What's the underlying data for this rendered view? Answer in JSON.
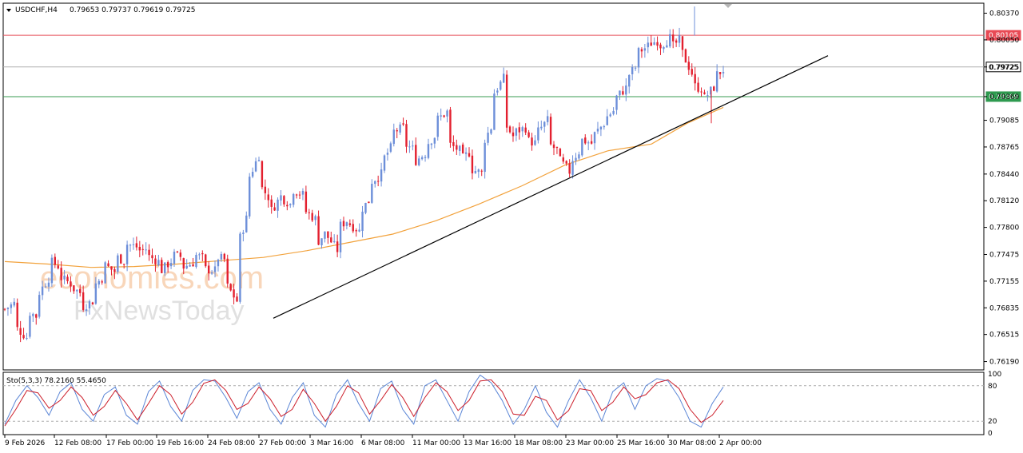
{
  "header": {
    "symbol": "USDCHF,H4",
    "quote": "0.79653 0.79737 0.79619 0.79725"
  },
  "watermark": {
    "line1": "economies.com",
    "line2": "FxNewsToday"
  },
  "colors": {
    "up": "#6d8fd9",
    "down": "#e3202f",
    "ma": "#f2a23c",
    "resistance": "#e8505b",
    "current": "#b0b0b0",
    "support": "#3a9b52",
    "trend": "#000000",
    "sto_main": "#5b86d6",
    "sto_signal": "#cc1f2b"
  },
  "chart_data": [
    {
      "type": "candlestick",
      "symbol": "USDCHF",
      "timeframe": "H4",
      "ylim": [
        0.7609,
        0.8049
      ],
      "y_ticks": [
        "0.80370",
        "0.80050",
        "0.79725",
        "0.79369",
        "0.79085",
        "0.78765",
        "0.78440",
        "0.78120",
        "0.77800",
        "0.77475",
        "0.77155",
        "0.76835",
        "0.76515",
        "0.76190"
      ],
      "x_ticks": [
        "9 Feb 2026",
        "12 Feb 08:00",
        "17 Feb 00:00",
        "19 Feb 16:00",
        "24 Feb 08:00",
        "27 Feb 00:00",
        "3 Mar 16:00",
        "6 Mar 08:00",
        "11 Mar 00:00",
        "13 Mar 16:00",
        "18 Mar 08:00",
        "23 Mar 00:00",
        "25 Mar 16:00",
        "30 Mar 08:00",
        "2 Apr 00:00"
      ],
      "price_levels": [
        {
          "label": "0.80105",
          "value": 0.80105,
          "role": "resistance"
        },
        {
          "label": "0.79725",
          "value": 0.79725,
          "role": "current"
        },
        {
          "label": "0.79369",
          "value": 0.79369,
          "role": "support"
        }
      ],
      "trendline": [
        {
          "bar": 0,
          "value": 0.7671
        },
        {
          "bar": 1,
          "value": 0.7986
        }
      ],
      "path": [
        [
          0.7682,
          0.769
        ],
        [
          0.766,
          0.7648
        ],
        [
          0.768,
          0.7672
        ],
        [
          0.77,
          0.772
        ],
        [
          0.774,
          0.7732
        ],
        [
          0.772,
          0.7712
        ],
        [
          0.7708,
          0.77
        ],
        [
          0.7685,
          0.7692
        ],
        [
          0.771,
          0.7722
        ],
        [
          0.7735,
          0.7726
        ],
        [
          0.7745,
          0.7738
        ],
        [
          0.776,
          0.7756
        ],
        [
          0.7752,
          0.7755
        ],
        [
          0.7745,
          0.7738
        ],
        [
          0.7727,
          0.774
        ],
        [
          0.7748,
          0.7744
        ],
        [
          0.7732,
          0.7738
        ],
        [
          0.7748,
          0.7742
        ],
        [
          0.773,
          0.7728
        ],
        [
          0.7745,
          0.774
        ],
        [
          0.771,
          0.769
        ],
        [
          0.776,
          0.78
        ],
        [
          0.784,
          0.787
        ],
        [
          0.783,
          0.7812
        ],
        [
          0.78,
          0.782
        ],
        [
          0.7815,
          0.7805
        ],
        [
          0.7825,
          0.7818
        ],
        [
          0.78,
          0.779
        ],
        [
          0.776,
          0.7775
        ],
        [
          0.777,
          0.7752
        ],
        [
          0.778,
          0.779
        ],
        [
          0.7785,
          0.7775
        ],
        [
          0.78,
          0.7815
        ],
        [
          0.7835,
          0.7845
        ],
        [
          0.786,
          0.788
        ],
        [
          0.7895,
          0.79
        ],
        [
          0.788,
          0.7872
        ],
        [
          0.786,
          0.787
        ],
        [
          0.788,
          0.7893
        ],
        [
          0.791,
          0.792
        ],
        [
          0.788,
          0.7872
        ],
        [
          0.786,
          0.7872
        ],
        [
          0.785,
          0.7845
        ],
        [
          0.788,
          0.7905
        ],
        [
          0.794,
          0.796
        ],
        [
          0.7905,
          0.7885
        ],
        [
          0.7895,
          0.79
        ],
        [
          0.7885,
          0.788
        ],
        [
          0.7895,
          0.791
        ],
        [
          0.788,
          0.787
        ],
        [
          0.786,
          0.7845
        ],
        [
          0.786,
          0.7875
        ],
        [
          0.7885,
          0.788
        ],
        [
          0.789,
          0.7905
        ],
        [
          0.791,
          0.7922
        ],
        [
          0.7935,
          0.7948
        ],
        [
          0.796,
          0.7975
        ],
        [
          0.799,
          0.7998
        ],
        [
          0.8,
          0.8005
        ],
        [
          0.7998,
          0.8008
        ],
        [
          0.7995,
          0.8008
        ],
        [
          0.799,
          0.7962
        ],
        [
          0.795,
          0.7945
        ],
        [
          0.7935,
          0.795
        ],
        [
          0.7962,
          0.7972
        ]
      ],
      "moving_average": [
        [
          0,
          0.7739
        ],
        [
          0.06,
          0.7736
        ],
        [
          0.12,
          0.7732
        ],
        [
          0.18,
          0.7733
        ],
        [
          0.24,
          0.7736
        ],
        [
          0.3,
          0.774
        ],
        [
          0.36,
          0.7744
        ],
        [
          0.42,
          0.7752
        ],
        [
          0.48,
          0.7762
        ],
        [
          0.54,
          0.7772
        ],
        [
          0.6,
          0.7788
        ],
        [
          0.66,
          0.7808
        ],
        [
          0.72,
          0.783
        ],
        [
          0.78,
          0.7855
        ],
        [
          0.84,
          0.7872
        ],
        [
          0.9,
          0.788
        ],
        [
          0.95,
          0.7905
        ],
        [
          1.0,
          0.7924
        ]
      ]
    },
    {
      "type": "line",
      "title": "Sto(5,3,3) 78.2160 55.4650",
      "ylim": [
        0,
        100
      ],
      "y_ticks": [
        "100",
        "80",
        "20",
        "0"
      ],
      "levels": [
        80,
        20
      ],
      "series": [
        {
          "role": "main",
          "values": [
            15,
            55,
            80,
            60,
            30,
            70,
            85,
            40,
            20,
            65,
            78,
            30,
            15,
            70,
            88,
            45,
            20,
            72,
            90,
            88,
            60,
            25,
            70,
            85,
            40,
            15,
            60,
            85,
            30,
            10,
            65,
            90,
            50,
            20,
            75,
            88,
            40,
            15,
            80,
            90,
            55,
            20,
            70,
            98,
            85,
            55,
            15,
            40,
            80,
            35,
            10,
            55,
            90,
            60,
            20,
            70,
            85,
            40,
            80,
            92,
            88,
            60,
            20,
            10,
            50,
            78
          ]
        },
        {
          "role": "signal",
          "values": [
            12,
            40,
            72,
            68,
            42,
            55,
            78,
            60,
            30,
            45,
            72,
            50,
            22,
            50,
            80,
            65,
            32,
            52,
            84,
            90,
            72,
            40,
            50,
            78,
            58,
            28,
            40,
            74,
            50,
            20,
            45,
            80,
            68,
            32,
            55,
            82,
            60,
            28,
            60,
            85,
            70,
            38,
            55,
            88,
            90,
            70,
            32,
            30,
            62,
            55,
            22,
            38,
            75,
            72,
            38,
            52,
            78,
            58,
            65,
            85,
            90,
            75,
            40,
            18,
            30,
            55
          ]
        }
      ]
    }
  ]
}
